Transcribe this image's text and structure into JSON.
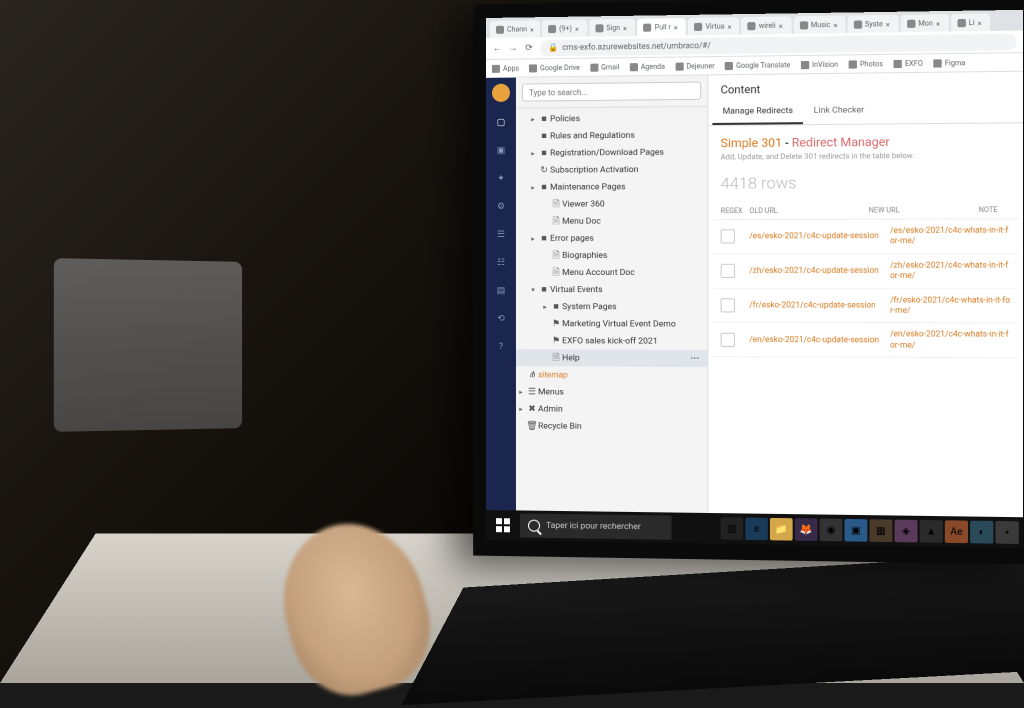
{
  "browser": {
    "tabs": [
      {
        "label": "Chann"
      },
      {
        "label": "(9+)"
      },
      {
        "label": "Sign"
      },
      {
        "label": "Pull r"
      },
      {
        "label": "Virtua"
      },
      {
        "label": "wireli"
      },
      {
        "label": "Music"
      },
      {
        "label": "Syste"
      },
      {
        "label": "Mon"
      },
      {
        "label": "Li"
      }
    ],
    "url": "cms-exfo.azurewebsites.net/umbraco/#/",
    "bookmarks": [
      {
        "label": "Apps"
      },
      {
        "label": "Google Drive"
      },
      {
        "label": "Gmail"
      },
      {
        "label": "Agenda"
      },
      {
        "label": "Dejeuner"
      },
      {
        "label": "Google Translate"
      },
      {
        "label": "InVision"
      },
      {
        "label": "Photos"
      },
      {
        "label": "EXFO"
      },
      {
        "label": "Figma"
      }
    ]
  },
  "search": {
    "placeholder": "Type to search..."
  },
  "tree": [
    {
      "level": 1,
      "icon": "folder",
      "label": "Policies",
      "arrow": "▸"
    },
    {
      "level": 1,
      "icon": "folder",
      "label": "Rules and Regulations"
    },
    {
      "level": 1,
      "icon": "folder",
      "label": "Registration/Download Pages",
      "arrow": "▸"
    },
    {
      "level": 1,
      "icon": "refresh",
      "label": "Subscription Activation"
    },
    {
      "level": 1,
      "icon": "folder",
      "label": "Maintenance Pages",
      "arrow": "▸"
    },
    {
      "level": 2,
      "icon": "doc",
      "label": "Viewer 360"
    },
    {
      "level": 2,
      "icon": "doc",
      "label": "Menu Doc"
    },
    {
      "level": 1,
      "icon": "folder",
      "label": "Error pages",
      "arrow": "▸"
    },
    {
      "level": 2,
      "icon": "doc",
      "label": "Biographies"
    },
    {
      "level": 2,
      "icon": "doc",
      "label": "Menu Account Doc"
    },
    {
      "level": 1,
      "icon": "folder",
      "label": "Virtual Events",
      "arrow": "▾"
    },
    {
      "level": 2,
      "icon": "folder",
      "label": "System Pages",
      "arrow": "▸"
    },
    {
      "level": 2,
      "icon": "flag",
      "label": "Marketing Virtual Event Demo"
    },
    {
      "level": 2,
      "icon": "flag",
      "label": "EXFO sales kick-off 2021"
    },
    {
      "level": 2,
      "icon": "doc",
      "label": "Help",
      "selected": true,
      "dots": true
    },
    {
      "level": 0,
      "icon": "tree",
      "label": "sitemap",
      "sitemap": true
    },
    {
      "level": 0,
      "icon": "menu",
      "label": "Menus",
      "arrow": "▸"
    },
    {
      "level": 0,
      "icon": "tools",
      "label": "Admin",
      "arrow": "▸"
    },
    {
      "level": 0,
      "icon": "trash",
      "label": "Recycle Bin"
    }
  ],
  "content": {
    "header": "Content",
    "tabs": [
      {
        "label": "Manage Redirects",
        "active": true
      },
      {
        "label": "Link Checker",
        "active": false
      }
    ],
    "title_a": "Simple 301",
    "title_sep": " - ",
    "title_b": "Redirect Manager",
    "subtitle": "Add, Update, and Delete 301 redirects in the table below.",
    "rowcount": "4418 rows",
    "columns": {
      "regex": "REGEX",
      "old": "OLD URL",
      "new": "NEW URL",
      "note": "NOTE"
    },
    "rows": [
      {
        "old": "/es/esko-2021/c4c-update-session",
        "new": "/es/esko-2021/c4c-whats-in-it-for-me/"
      },
      {
        "old": "/zh/esko-2021/c4c-update-session",
        "new": "/zh/esko-2021/c4c-whats-in-it-for-me/"
      },
      {
        "old": "/fr/esko-2021/c4c-update-session",
        "new": "/fr/esko-2021/c4c-whats-in-it-for-me/"
      },
      {
        "old": "/en/esko-2021/c4c-update-session",
        "new": "/en/esko-2021/c4c-whats-in-it-for-me/"
      }
    ]
  },
  "taskbar": {
    "search": "Taper ici pour rechercher"
  }
}
